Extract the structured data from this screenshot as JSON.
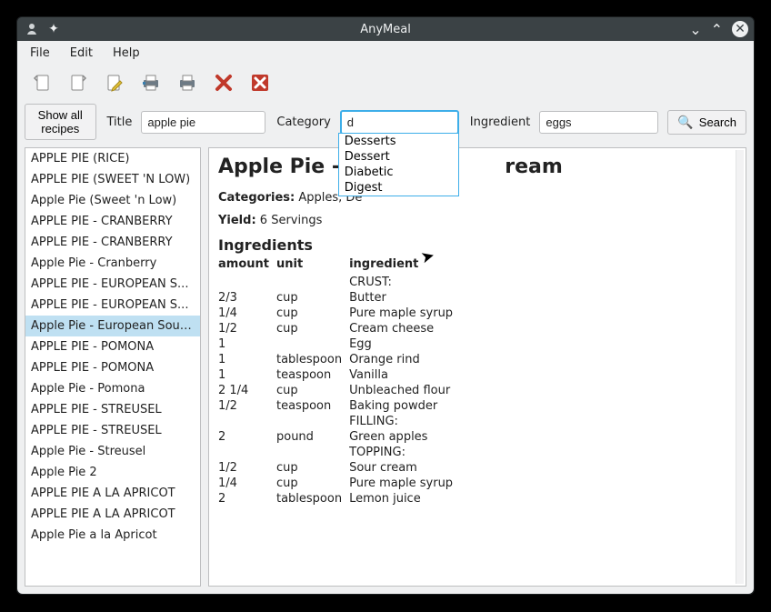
{
  "window": {
    "title": "AnyMeal"
  },
  "menubar": {
    "file": "File",
    "edit": "Edit",
    "help": "Help"
  },
  "filter": {
    "show_all": "Show all recipes",
    "title_label": "Title",
    "title_value": "apple pie",
    "category_label": "Category",
    "category_value": "d",
    "ingredient_label": "Ingredient",
    "ingredient_value": "eggs",
    "search_label": "Search"
  },
  "autocomplete": [
    "Desserts",
    "Dessert",
    "Diabetic",
    "Digest"
  ],
  "recipe_list": {
    "selected_index": 8,
    "items": [
      "APPLE PIE (RICE)",
      "APPLE PIE (SWEET 'N LOW)",
      "Apple Pie (Sweet 'n Low)",
      "APPLE PIE - CRANBERRY",
      "APPLE PIE - CRANBERRY",
      "Apple Pie - Cranberry",
      "APPLE PIE - EUROPEAN S...",
      "APPLE PIE - EUROPEAN S...",
      "Apple Pie - European Sour...",
      "APPLE PIE - POMONA",
      "APPLE PIE - POMONA",
      "Apple Pie - Pomona",
      "APPLE PIE - STREUSEL",
      "APPLE PIE - STREUSEL",
      "Apple Pie - Streusel",
      "Apple Pie 2",
      "APPLE PIE A LA APRICOT",
      "APPLE PIE A LA APRICOT",
      "Apple Pie a la Apricot"
    ]
  },
  "detail": {
    "title_visible_left": "Apple Pie - Eur",
    "title_visible_right": "ream",
    "categories_label": "Categories:",
    "categories_visible": "Apples, De",
    "yield_label": "Yield:",
    "yield_value": "6 Servings",
    "ingredients_heading": "Ingredients",
    "cols": {
      "amount": "amount",
      "unit": "unit",
      "ingredient": "ingredient"
    },
    "rows": [
      {
        "amount": "",
        "unit": "",
        "ingredient": "CRUST:"
      },
      {
        "amount": "2/3",
        "unit": "cup",
        "ingredient": "Butter"
      },
      {
        "amount": "1/4",
        "unit": "cup",
        "ingredient": "Pure maple syrup"
      },
      {
        "amount": "1/2",
        "unit": "cup",
        "ingredient": "Cream cheese"
      },
      {
        "amount": "1",
        "unit": "",
        "ingredient": "Egg"
      },
      {
        "amount": "1",
        "unit": "tablespoon",
        "ingredient": "Orange rind"
      },
      {
        "amount": "1",
        "unit": "teaspoon",
        "ingredient": "Vanilla"
      },
      {
        "amount": "2 1/4",
        "unit": "cup",
        "ingredient": "Unbleached flour"
      },
      {
        "amount": "1/2",
        "unit": "teaspoon",
        "ingredient": "Baking powder"
      },
      {
        "amount": "",
        "unit": "",
        "ingredient": "FILLING:"
      },
      {
        "amount": "2",
        "unit": "pound",
        "ingredient": "Green apples"
      },
      {
        "amount": "",
        "unit": "",
        "ingredient": "TOPPING:"
      },
      {
        "amount": "1/2",
        "unit": "cup",
        "ingredient": "Sour cream"
      },
      {
        "amount": "1/4",
        "unit": "cup",
        "ingredient": "Pure maple syrup"
      },
      {
        "amount": "2",
        "unit": "tablespoon",
        "ingredient": "Lemon juice"
      }
    ]
  }
}
